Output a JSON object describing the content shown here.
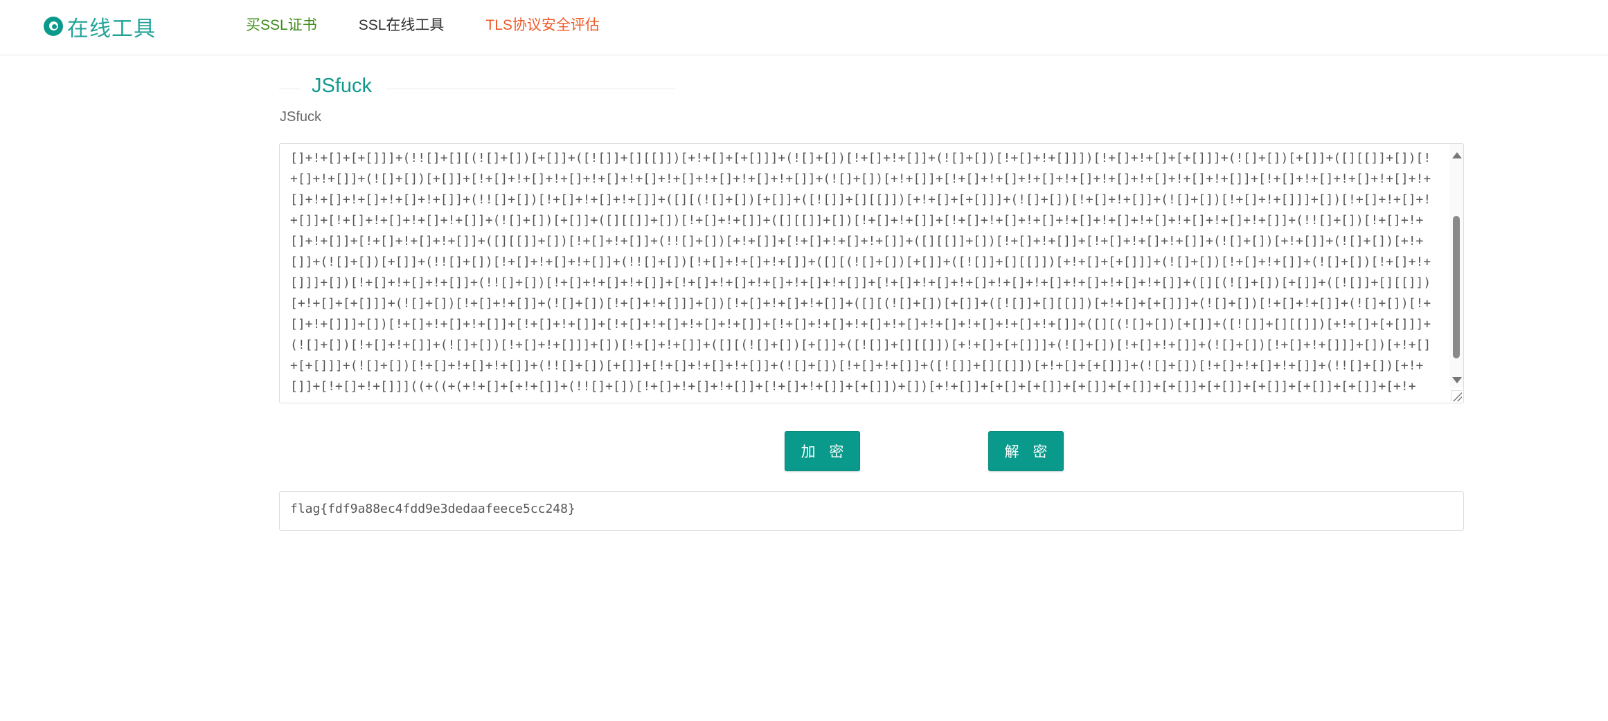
{
  "header": {
    "logo_text": "在线工具",
    "nav": [
      {
        "label": "买SSL证书",
        "color": "#3c8d1a"
      },
      {
        "label": "SSL在线工具",
        "color": "#333333"
      },
      {
        "label": "TLS协议安全评估",
        "color": "#f05a28"
      }
    ]
  },
  "section": {
    "title": "JSfuck",
    "label": "JSfuck"
  },
  "input": {
    "value": "[]+!+[]+[+[]]]+(!![]+[][(![]+[])[+[]]+([![]]+[][[]])[+!+[]+[+[]]]+(![]+[])[!+[]+!+[]]+(![]+[])[!+[]+!+[]]])[!+[]+!+[]+[+[]]]+(![]+[])[+[]]+([][[]]+[])[!+[]+!+[]]+(![]+[])[+[]]+[!+[]+!+[]+!+[]+!+[]+!+[]+!+[]+!+[]+!+[]+!+[]]+(![]+[])[+!+[]]+[!+[]+!+[]+!+[]+!+[]+!+[]+!+[]+!+[]+!+[]]+[!+[]+!+[]+!+[]+!+[]+!+[]+!+[]+!+[]+!+[]+!+[]]+(!![]+[])[!+[]+!+[]+!+[]]+([][(![]+[])[+[]]+([![]]+[][[]])[+!+[]+[+[]]]+(![]+[])[!+[]+!+[]]+(![]+[])[!+[]+!+[]]]+[])[!+[]+!+[]+!+[]]+[!+[]+!+[]+!+[]+!+[]]+(![]+[])[+[]]+([][[]]+[])[!+[]+!+[]]+([][[]]+[])[!+[]+!+[]]+[!+[]+!+[]+!+[]+!+[]+!+[]+!+[]+!+[]+!+[]+!+[]]+(!![]+[])[!+[]+!+[]+!+[]]+[!+[]+!+[]+!+[]]+([][[]]+[])[!+[]+!+[]]+(!![]+[])[+!+[]]+[!+[]+!+[]+!+[]]+([][[]]+[])[!+[]+!+[]]+[!+[]+!+[]+!+[]]+(![]+[])[+!+[]]+(![]+[])[+!+[]]+(![]+[])[+[]]+(!![]+[])[!+[]+!+[]+!+[]]+(!![]+[])[!+[]+!+[]+!+[]]+([][(![]+[])[+[]]+([![]]+[][[]])[+!+[]+[+[]]]+(![]+[])[!+[]+!+[]]+(![]+[])[!+[]+!+[]]]+[])[!+[]+!+[]+!+[]]+(!![]+[])[!+[]+!+[]+!+[]]+[!+[]+!+[]+!+[]+!+[]+!+[]]+[!+[]+!+[]+!+[]+!+[]+!+[]+!+[]+!+[]+!+[]]+([][(![]+[])[+[]]+([![]]+[][[]])[+!+[]+[+[]]]+(![]+[])[!+[]+!+[]]+(![]+[])[!+[]+!+[]]]+[])[!+[]+!+[]+!+[]]+([][(![]+[])[+[]]+([![]]+[][[]])[+!+[]+[+[]]]+(![]+[])[!+[]+!+[]]+(![]+[])[!+[]+!+[]]]+[])[!+[]+!+[]+!+[]]+[!+[]+!+[]]+[!+[]+!+[]+!+[]+!+[]]+[!+[]+!+[]+!+[]+!+[]+!+[]+!+[]+!+[]+!+[]]+([][(![]+[])[+[]]+([![]]+[][[]])[+!+[]+[+[]]]+(![]+[])[!+[]+!+[]]+(![]+[])[!+[]+!+[]]]+[])[!+[]+!+[]]+([][(![]+[])[+[]]+([![]]+[][[]])[+!+[]+[+[]]]+(![]+[])[!+[]+!+[]]+(![]+[])[!+[]+!+[]]]+[])[+!+[]+[+[]]]+(![]+[])[!+[]+!+[]+!+[]]+(!![]+[])[+[]]+[!+[]+!+[]+!+[]]+(![]+[])[!+[]+!+[]]+([![]]+[][[]])[+!+[]+[+[]]]+(![]+[])[!+[]+!+[]+!+[]]+(!![]+[])[+!+[]]+[!+[]+!+[]]]((+((+(+!+[]+[+!+[]]+(!![]+[])[!+[]+!+[]+!+[]]+[!+[]+!+[]]+[+[]])+[])[+!+[]]+[+[]+[+[]]+[+[]]+[+[]]+[+[]]+[+[]]+[+[]]+[+[]]+[+[]]+[+!+[]]])+[])[!+[]+!+[]]+[+!+[]])"
  },
  "buttons": {
    "encrypt": "加 密",
    "decrypt": "解 密"
  },
  "output": {
    "value": "flag{fdf9a88ec4fdd9e3dedaafeece5cc248}"
  },
  "colors": {
    "accent": "#0a9a8c"
  }
}
